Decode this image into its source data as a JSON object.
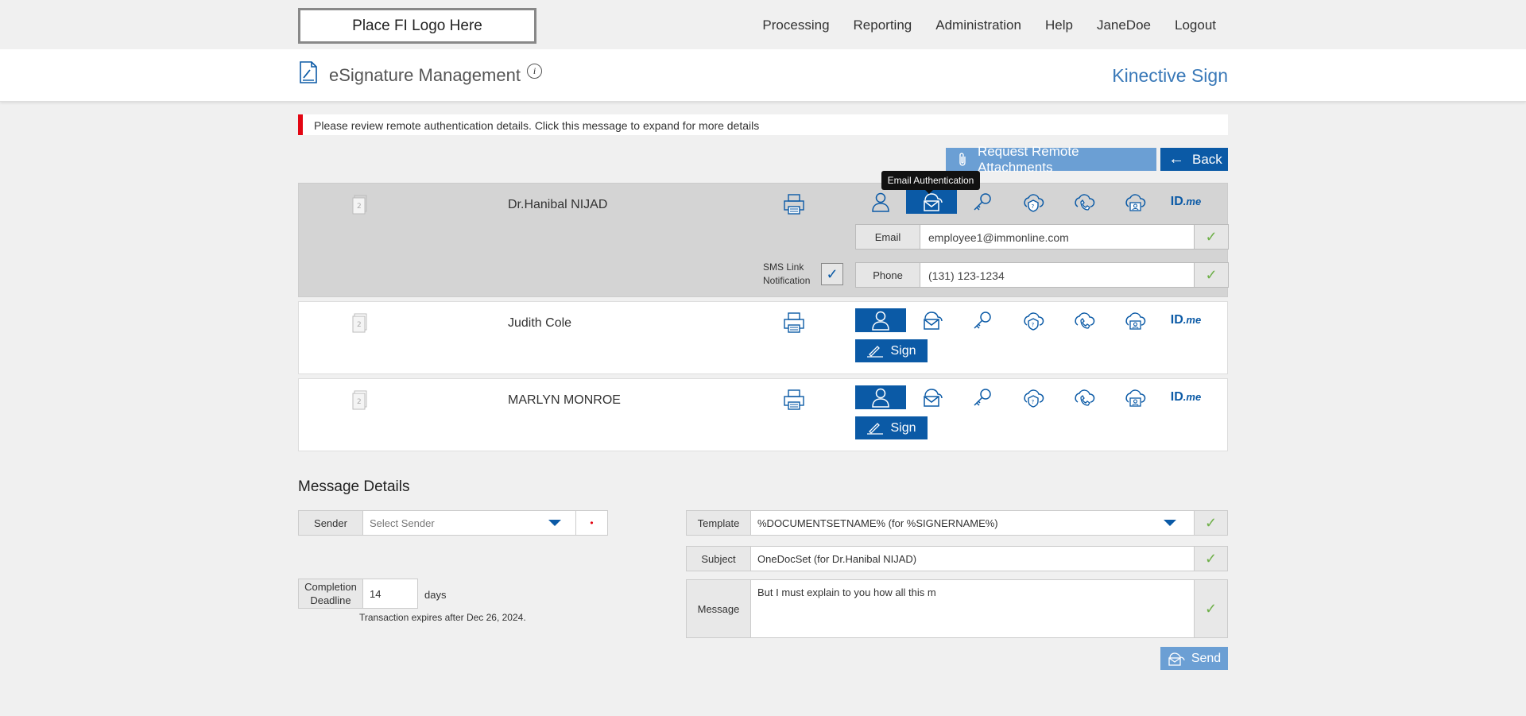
{
  "topbar": {
    "logo_text": "Place FI Logo Here",
    "nav": [
      "Processing",
      "Reporting",
      "Administration",
      "Help",
      "JaneDoe",
      "Logout"
    ]
  },
  "header": {
    "title": "eSignature Management",
    "info_icon": "i",
    "brand": "Kinective Sign"
  },
  "alert": {
    "text": "Please review remote authentication details. Click this message to expand for more details",
    "color": "#e30613"
  },
  "actions": {
    "attachments_label": "Request Remote Attachments",
    "back_label": "Back",
    "back_arrow": "←"
  },
  "tooltip": "Email Authentication",
  "auth_methods": [
    "person-icon",
    "email-icon",
    "key-icon",
    "cloud-question-icon",
    "cloud-phone-icon",
    "cloud-id-icon",
    "idme-logo"
  ],
  "idme": {
    "main": "ID",
    "suffix": ".me"
  },
  "signers": [
    {
      "doc_count": "2",
      "name": "Dr.Hanibal NIJAD",
      "selected_auth": "email",
      "email_label": "Email",
      "email_value": "employee1@immonline.com",
      "phone_label": "Phone",
      "phone_value": "(131) 123-1234",
      "sms_label_1": "SMS Link",
      "sms_label_2": "Notification",
      "check": "✓"
    },
    {
      "doc_count": "2",
      "name": "Judith Cole",
      "selected_auth": "person",
      "sign_label": "Sign"
    },
    {
      "doc_count": "2",
      "name": "MARLYN MONROE",
      "selected_auth": "person",
      "sign_label": "Sign"
    }
  ],
  "message": {
    "section_title": "Message Details",
    "sender_label": "Sender",
    "sender_placeholder": "Select Sender",
    "sender_required_mark": "•",
    "deadline_label_1": "Completion",
    "deadline_label_2": "Deadline",
    "deadline_value": "14",
    "days_label": "days",
    "expires_text": "Transaction expires after Dec 26, 2024.",
    "template_label": "Template",
    "template_value": "%DOCUMENTSETNAME% (for %SIGNERNAME%)",
    "subject_label": "Subject",
    "subject_value": "OneDocSet (for Dr.Hanibal NIJAD)",
    "message_label": "Message",
    "message_value": "But I must explain to you how all this m",
    "check": "✓",
    "send_label": "Send"
  },
  "colors": {
    "primary": "#0b5aa6",
    "light_primary": "#6b9fd4",
    "check": "#6fb04a",
    "brand": "#3a79b8"
  }
}
